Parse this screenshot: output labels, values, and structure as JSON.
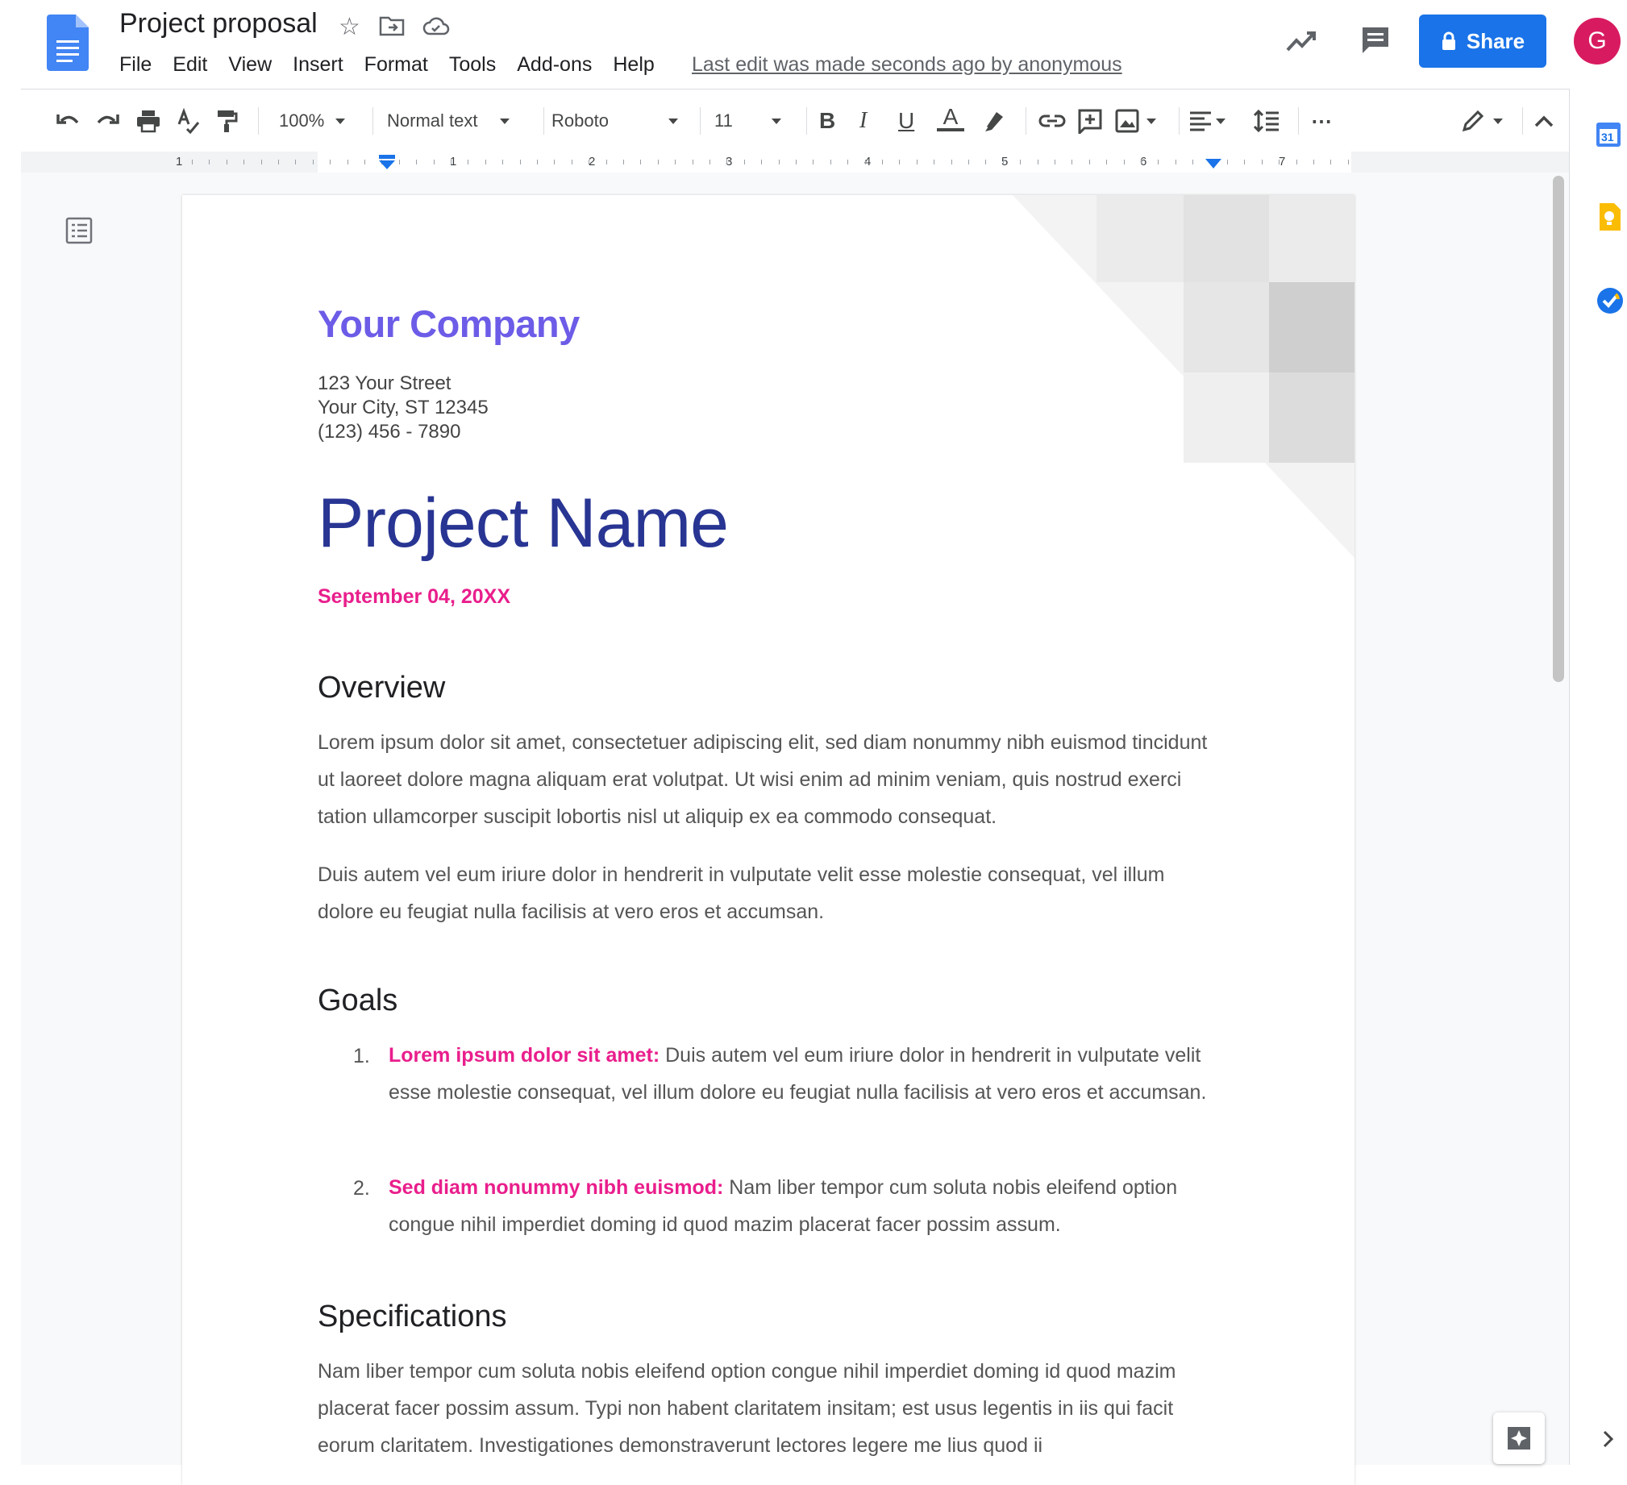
{
  "doc_title": "Project proposal",
  "menu": [
    "File",
    "Edit",
    "View",
    "Insert",
    "Format",
    "Tools",
    "Add-ons",
    "Help"
  ],
  "last_edit": "Last edit was made seconds ago by anonymous",
  "share_label": "Share",
  "avatar_letter": "G",
  "toolbar": {
    "zoom": "100%",
    "style": "Normal text",
    "font": "Roboto",
    "size": "11",
    "bold": "B",
    "italic": "I",
    "underline": "U",
    "text_color": "A",
    "more": "⋯"
  },
  "ruler_numbers": [
    "1",
    "1",
    "2",
    "3",
    "4",
    "5",
    "6",
    "7"
  ],
  "side_panel": {
    "calendar_label": "31"
  },
  "document": {
    "company": "Your Company",
    "address": [
      "123 Your Street",
      "Your City, ST 12345",
      "(123) 456 - 7890"
    ],
    "project_name": "Project Name",
    "date": "September 04, 20XX",
    "overview_heading": "Overview",
    "overview_p1": "Lorem ipsum dolor sit amet, consectetuer adipiscing elit, sed diam nonummy nibh euismod tincidunt ut laoreet dolore magna aliquam erat volutpat. Ut wisi enim ad minim veniam, quis nostrud exerci tation ullamcorper suscipit lobortis nisl ut aliquip ex ea commodo consequat.",
    "overview_p2": "Duis autem vel eum iriure dolor in hendrerit in vulputate velit esse molestie consequat, vel illum dolore eu feugiat nulla facilisis at vero eros et accumsan.",
    "goals_heading": "Goals",
    "goals": [
      {
        "num": "1.",
        "lead": "Lorem ipsum dolor sit amet:",
        "text": " Duis autem vel eum iriure dolor in hendrerit in vulputate velit esse molestie consequat, vel illum dolore eu feugiat nulla facilisis at vero eros et accumsan."
      },
      {
        "num": "2.",
        "lead": "Sed diam nonummy nibh euismod:",
        "text": " Nam liber tempor cum soluta nobis eleifend option congue nihil imperdiet doming id quod mazim placerat facer possim assum."
      }
    ],
    "specs_heading": "Specifications",
    "specs_p1": "Nam liber tempor cum soluta nobis eleifend option congue nihil imperdiet doming id quod mazim placerat facer possim assum. Typi non habent claritatem insitam; est usus legentis in iis qui facit eorum claritatem. Investigationes demonstraverunt lectores legere me lius quod ii"
  },
  "colors": {
    "accent": "#1a73e8",
    "company": "#6c5ce7",
    "project_name": "#283593",
    "highlight": "#e91e8c",
    "avatar": "#d81b60"
  }
}
